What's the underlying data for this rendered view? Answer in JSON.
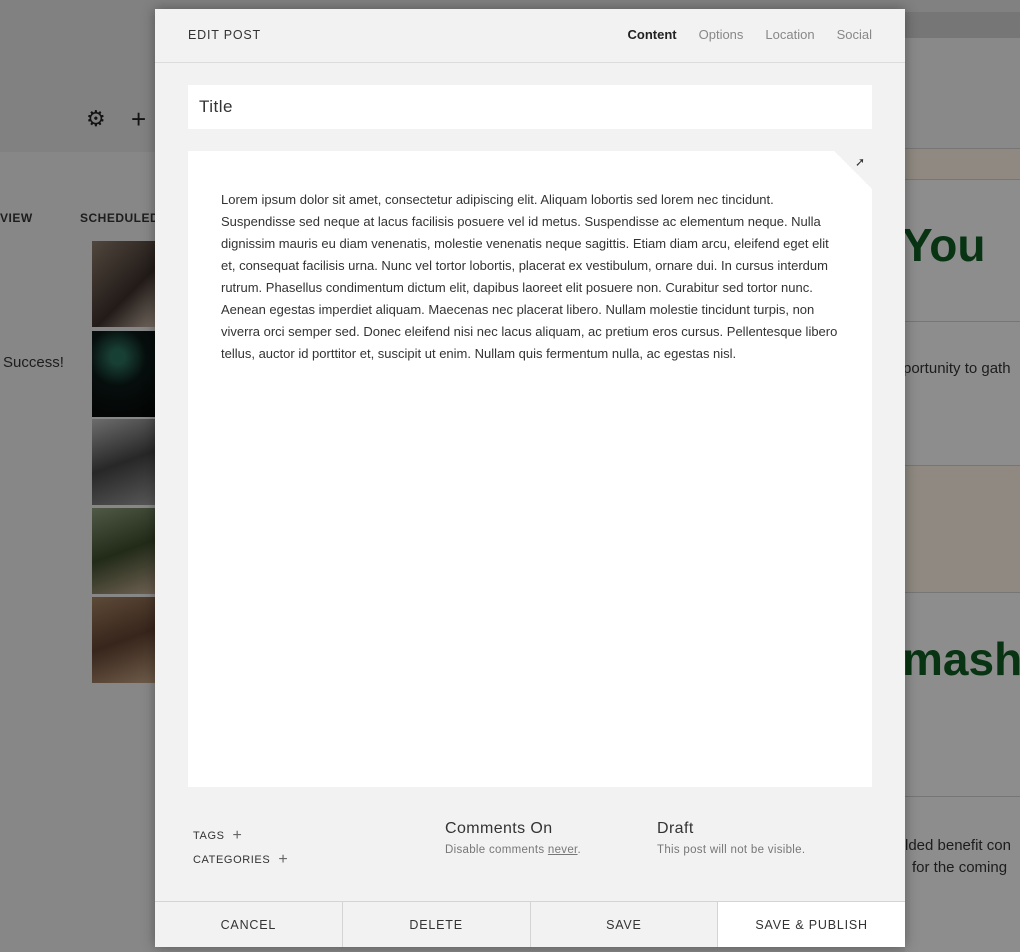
{
  "background": {
    "tab_left": "VIEW",
    "tab_scheduled": "SCHEDULED",
    "success_text": "Success!",
    "heading_you": "You",
    "opportunity_text": "portunity to gath",
    "heading_mash": "mashi",
    "benefit_line1": "lded benefit con",
    "benefit_line2": "for the coming"
  },
  "modal": {
    "title": "EDIT POST",
    "tabs": [
      "Content",
      "Options",
      "Location",
      "Social"
    ],
    "active_tab": "Content",
    "title_placeholder": "Title",
    "body": "Lorem ipsum dolor sit amet, consectetur adipiscing elit. Aliquam lobortis sed lorem nec tincidunt. Suspendisse sed neque at lacus facilisis posuere vel id metus. Suspendisse ac elementum neque. Nulla dignissim mauris eu diam venenatis, molestie venenatis neque sagittis. Etiam diam arcu, eleifend eget elit et, consequat facilisis urna. Nunc vel tortor lobortis, placerat ex vestibulum, ornare dui. In cursus interdum rutrum. Phasellus condimentum dictum elit, dapibus laoreet elit posuere non. Curabitur sed tortor nunc. Aenean egestas imperdiet aliquam. Maecenas nec placerat libero. Nullam molestie tincidunt turpis, non viverra orci semper sed. Donec eleifend nisi nec lacus aliquam, ac pretium eros cursus. Pellentesque libero tellus, auctor id porttitor et, suscipit ut enim. Nullam quis fermentum nulla, ac egestas nisl.",
    "tags_label": "TAGS",
    "categories_label": "CATEGORIES",
    "comments": {
      "heading": "Comments On",
      "sub_prefix": "Disable comments ",
      "sub_link": "never",
      "sub_suffix": "."
    },
    "status": {
      "heading": "Draft",
      "sub": "This post will not be visible."
    },
    "footer": {
      "cancel": "CANCEL",
      "delete": "DELETE",
      "save": "SAVE",
      "save_publish": "SAVE & PUBLISH"
    }
  }
}
